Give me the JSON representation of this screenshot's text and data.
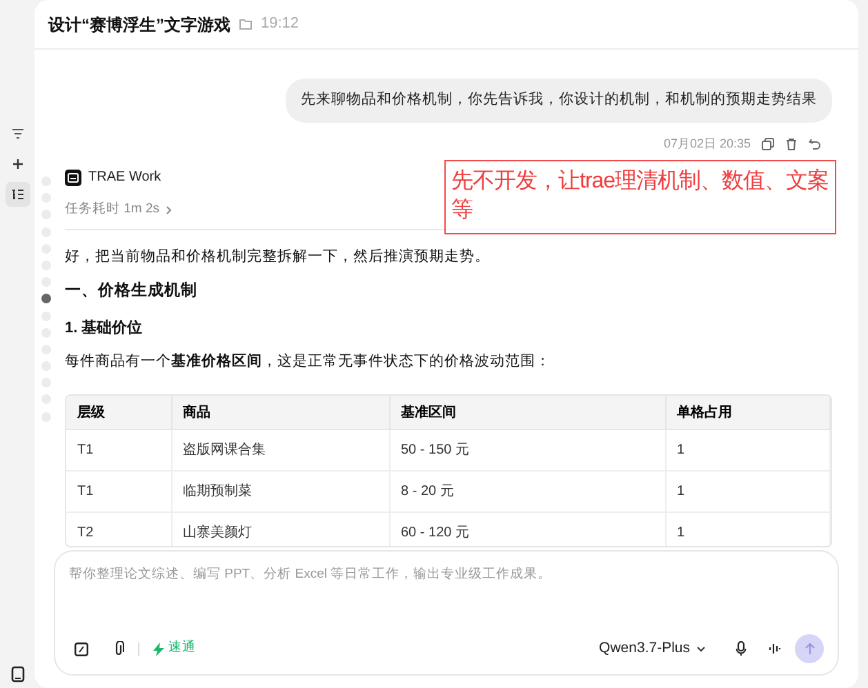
{
  "header": {
    "title": "设计“赛博浮生”文字游戏",
    "time": "19:12"
  },
  "side_tools": [
    {
      "kind": "filter",
      "selected": false
    },
    {
      "kind": "plus",
      "selected": false
    },
    {
      "kind": "outline",
      "selected": true
    }
  ],
  "nav_dots": [
    {
      "selected": false
    },
    {
      "selected": false
    },
    {
      "selected": false
    },
    {
      "selected": false
    },
    {
      "selected": false
    },
    {
      "selected": false
    },
    {
      "selected": false
    },
    {
      "selected": true
    },
    {
      "selected": false
    },
    {
      "selected": false
    },
    {
      "selected": false
    },
    {
      "selected": false
    },
    {
      "selected": false
    },
    {
      "selected": false
    },
    {
      "selected": false
    }
  ],
  "user_message": {
    "text": "先来聊物品和价格机制，你先告诉我，你设计的机制，和机制的预期走势结果",
    "time": "07月02日 20:35"
  },
  "assistant": {
    "name": "TRAE Work",
    "duration": "任务耗时 1m 2s"
  },
  "annotation": "先不开发，让trae理清机制、数值、文案等",
  "content": [
    {
      "kind": "p",
      "text": "好，把当前物品和价格机制完整拆解一下，然后推演预期走势。"
    },
    {
      "kind": "h2",
      "text": "一、价格生成机制"
    },
    {
      "kind": "h3",
      "text": "1. 基础价位"
    },
    {
      "kind": "p",
      "text": "每件商品有一个**基准价格区间**，这是正常无事件状态下的价格波动范围："
    }
  ],
  "table": {
    "columns": [
      "层级",
      "商品",
      "基准区间",
      "单格占用"
    ],
    "rows": [
      [
        "T1",
        "盗版网课合集",
        "50 - 150 元",
        "1"
      ],
      [
        "T1",
        "临期预制菜",
        "8 - 20 元",
        "1"
      ],
      [
        "T2",
        "山寨美颜灯",
        "60 - 120 元",
        "1"
      ]
    ]
  },
  "composer": {
    "placeholder": "帮你整理论文综述、编写 PPT、分析 Excel 等日常工作，输出专业级工作成果。",
    "mode": "速通",
    "model": "Qwen3.7-Plus"
  }
}
